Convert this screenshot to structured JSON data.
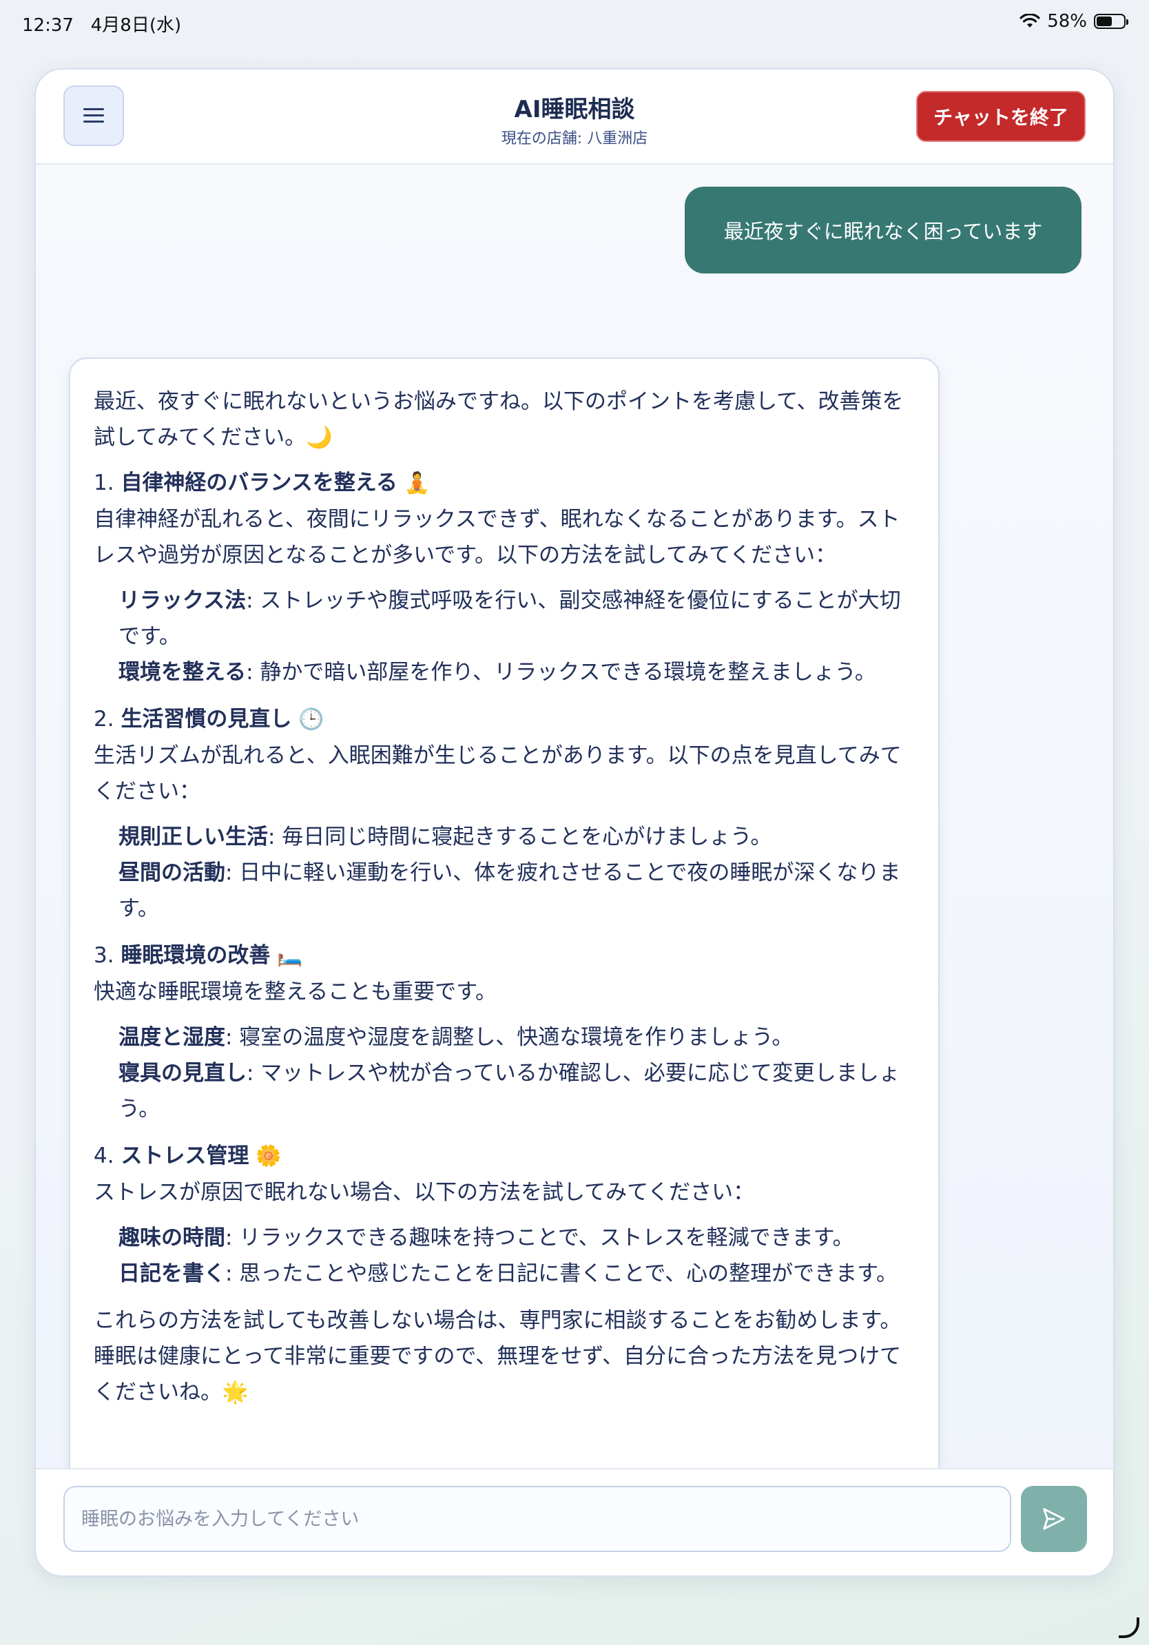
{
  "status_bar": {
    "time": "12:37",
    "date": "4月8日(水)",
    "battery_percent": "58%",
    "battery_level": 0.58
  },
  "header": {
    "title": "AI睡眠相談",
    "subtitle": "現在の店舗: 八重洲店",
    "end_chat_label": "チャットを終了",
    "menu_icon": "hamburger-menu-icon"
  },
  "messages": {
    "user": "最近夜すぐに眠れなく困っています",
    "ai": {
      "intro": "最近、夜すぐに眠れないというお悩みですね。以下のポイントを考慮して、改善策を試してみてください。🌙",
      "sections": [
        {
          "number": "1.",
          "title": "自律神経のバランスを整える",
          "emoji": "🧘",
          "body": "自律神経が乱れると、夜間にリラックスできず、眠れなくなることがあります。ストレスや過労が原因となることが多いです。以下の方法を試してみてください：",
          "points": [
            {
              "label": "リラックス法",
              "text": ": ストレッチや腹式呼吸を行い、副交感神経を優位にすることが大切です。"
            },
            {
              "label": "環境を整える",
              "text": ": 静かで暗い部屋を作り、リラックスできる環境を整えましょう。"
            }
          ]
        },
        {
          "number": "2.",
          "title": "生活習慣の見直し",
          "emoji": "🕒",
          "body": "生活リズムが乱れると、入眠困難が生じることがあります。以下の点を見直してみてください：",
          "points": [
            {
              "label": "規則正しい生活",
              "text": ": 毎日同じ時間に寝起きすることを心がけましょう。"
            },
            {
              "label": "昼間の活動",
              "text": ": 日中に軽い運動を行い、体を疲れさせることで夜の睡眠が深くなります。"
            }
          ]
        },
        {
          "number": "3.",
          "title": "睡眠環境の改善",
          "emoji": "🛏️",
          "body": "快適な睡眠環境を整えることも重要です。",
          "points": [
            {
              "label": "温度と湿度",
              "text": ": 寝室の温度や湿度を調整し、快適な環境を作りましょう。"
            },
            {
              "label": "寝具の見直し",
              "text": ": マットレスや枕が合っているか確認し、必要に応じて変更しましょう。"
            }
          ]
        },
        {
          "number": "4.",
          "title": "ストレス管理",
          "emoji": "🌼",
          "body": "ストレスが原因で眠れない場合、以下の方法を試してみてください：",
          "points": [
            {
              "label": "趣味の時間",
              "text": ": リラックスできる趣味を持つことで、ストレスを軽減できます。"
            },
            {
              "label": "日記を書く",
              "text": ": 思ったことや感じたことを日記に書くことで、心の整理ができます。"
            }
          ]
        }
      ],
      "closing": "これらの方法を試しても改善しない場合は、専門家に相談することをお勧めします。睡眠は健康にとって非常に重要ですので、無理をせず、自分に合った方法を見つけてくださいね。🌟"
    }
  },
  "input": {
    "placeholder": "睡眠のお悩みを入力してください",
    "value": "",
    "send_icon": "send-icon"
  },
  "colors": {
    "user_bubble": "#377872",
    "end_chat_button": "#c42a2a",
    "send_button": "#7fb0aa",
    "text_primary": "#22305a"
  }
}
